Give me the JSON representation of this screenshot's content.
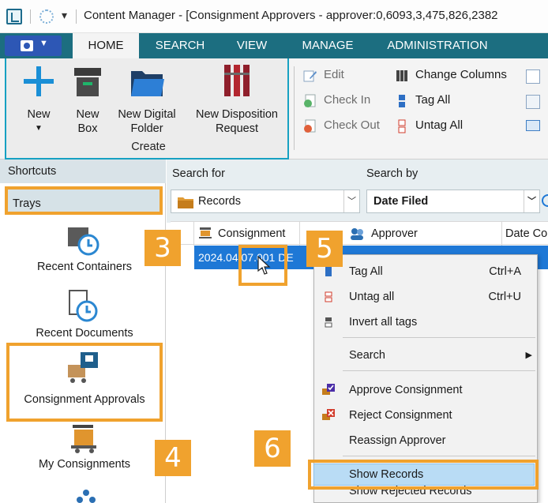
{
  "window": {
    "title": "Content Manager - [Consignment Approvers - approver:0,6093,3,475,826,2382"
  },
  "ribbon": {
    "tabs": [
      "HOME",
      "SEARCH",
      "VIEW",
      "MANAGE",
      "ADMINISTRATION"
    ],
    "active_tab": "HOME",
    "create_group": {
      "label": "Create",
      "new": "New",
      "new_box": "New Box",
      "new_digital_folder": "New Digital Folder",
      "new_disposition_request": "New Disposition Request"
    },
    "record_group": {
      "edit": "Edit",
      "check_in": "Check In",
      "check_out": "Check Out",
      "change_columns": "Change Columns",
      "tag_all": "Tag All",
      "untag_all": "Untag All"
    }
  },
  "sidebar": {
    "shortcuts": "Shortcuts",
    "trays": "Trays",
    "items": [
      {
        "label": "Recent Containers"
      },
      {
        "label": "Recent Documents"
      },
      {
        "label": "Consignment Approvals"
      },
      {
        "label": "My Consignments"
      }
    ]
  },
  "search": {
    "search_for_label": "Search for",
    "search_for_value": "Records",
    "search_by_label": "Search by",
    "search_by_value": "Date Filed"
  },
  "grid": {
    "columns": [
      "Consignment",
      "Approver",
      "Date Co"
    ],
    "rows": [
      {
        "consignment": "2024.04.07.001 DE"
      }
    ]
  },
  "context_menu": {
    "items": [
      {
        "label": "Tag All",
        "shortcut": "Ctrl+A"
      },
      {
        "label": "Untag all",
        "shortcut": "Ctrl+U"
      },
      {
        "label": "Invert all tags",
        "shortcut": ""
      },
      {
        "label": "Search",
        "shortcut": "▶"
      },
      {
        "label": "Approve Consignment",
        "shortcut": ""
      },
      {
        "label": "Reject Consignment",
        "shortcut": ""
      },
      {
        "label": "Reassign Approver",
        "shortcut": ""
      },
      {
        "label": "Show Records",
        "shortcut": ""
      },
      {
        "label": "Show Rejected Records",
        "shortcut": ""
      }
    ],
    "highlighted": "Show Records"
  },
  "callouts": [
    "3",
    "4",
    "5",
    "6"
  ],
  "colors": {
    "accent": "#f0a22e",
    "ribbon_tab_bar": "#1c6e80",
    "selection": "#1e78d6",
    "menu_hover": "#b9dcf5"
  }
}
